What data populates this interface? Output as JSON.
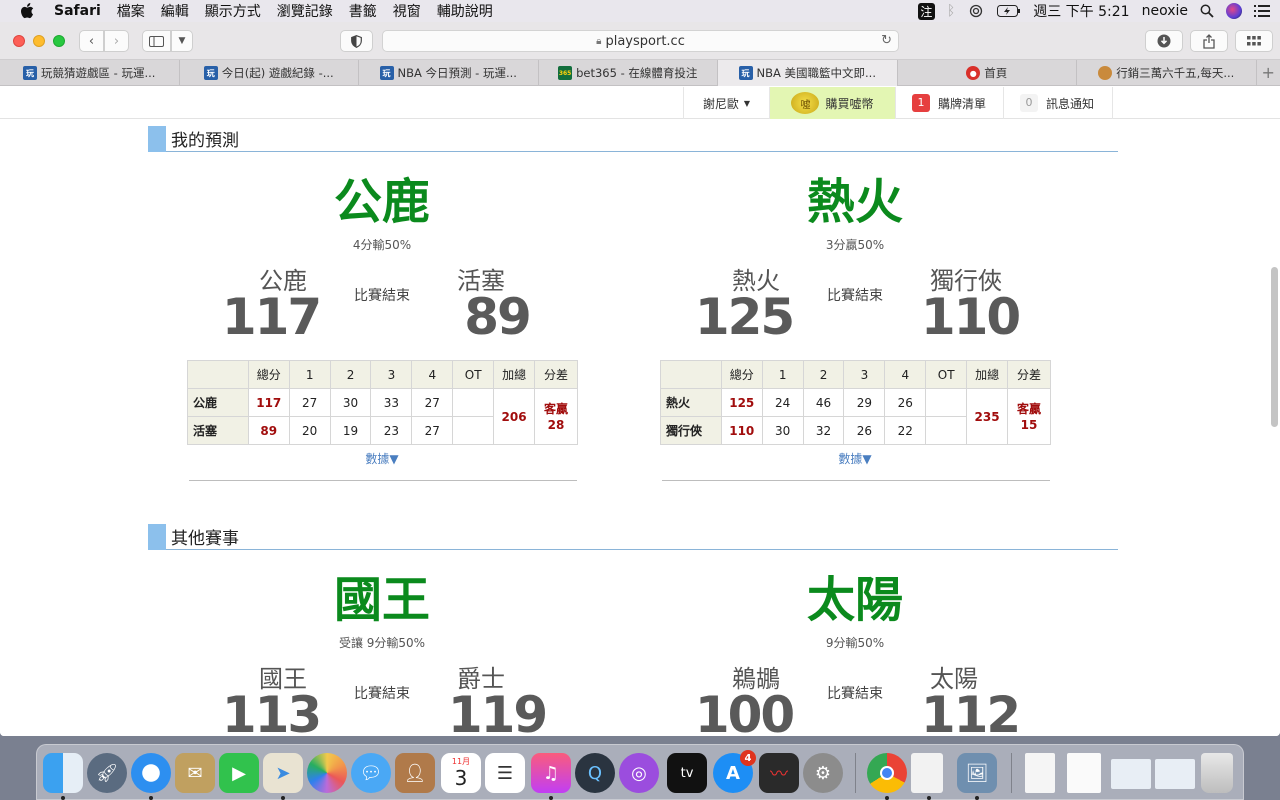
{
  "menubar": {
    "app": "Safari",
    "items": [
      "檔案",
      "編輯",
      "顯示方式",
      "瀏覽記錄",
      "書籤",
      "視窗",
      "輔助說明"
    ],
    "ime": "注",
    "clock": "週三 下午 5:21",
    "user": "neoxie"
  },
  "browser": {
    "url": "playsport.cc",
    "tabs": [
      {
        "label": "玩競猜遊戲區 - 玩運...",
        "favicon": "playsport",
        "active": false
      },
      {
        "label": "今日(起) 遊戲紀錄 -...",
        "favicon": "playsport",
        "active": false
      },
      {
        "label": "NBA 今日預測 - 玩運...",
        "favicon": "playsport",
        "active": false
      },
      {
        "label": "bet365 - 在線體育投注",
        "favicon": "bet365",
        "active": false
      },
      {
        "label": "NBA 美國職籃中文即...",
        "favicon": "playsport",
        "active": true
      },
      {
        "label": "首頁",
        "favicon": "home",
        "active": false
      },
      {
        "label": "行銷三萬六千五,每天...",
        "favicon": "bird",
        "active": false
      }
    ]
  },
  "header": {
    "user": "謝尼歐",
    "buy_coins": "購買噓幣",
    "cart_count": "1",
    "cart_label": "購牌清單",
    "notify_count": "0",
    "notify_label": "訊息通知"
  },
  "sections": {
    "mine": "我的預測",
    "others": "其他賽事"
  },
  "table_headers": [
    "總分",
    "1",
    "2",
    "3",
    "4",
    "OT",
    "加總",
    "分差"
  ],
  "games": [
    {
      "winner": "公鹿",
      "spread": "4分輸50%",
      "status": "比賽結束",
      "home": {
        "name": "公鹿",
        "score": "117",
        "quarters": [
          "27",
          "30",
          "33",
          "27"
        ],
        "ot": ""
      },
      "away": {
        "name": "活塞",
        "score": "89",
        "quarters": [
          "20",
          "19",
          "23",
          "27"
        ],
        "ot": ""
      },
      "sum": "206",
      "diff_label": "客贏",
      "diff_value": "28",
      "more": "數據▼"
    },
    {
      "winner": "熱火",
      "spread": "3分贏50%",
      "status": "比賽結束",
      "home": {
        "name": "熱火",
        "score": "125",
        "quarters": [
          "24",
          "46",
          "29",
          "26"
        ],
        "ot": ""
      },
      "away": {
        "name": "獨行俠",
        "score": "110",
        "quarters": [
          "30",
          "32",
          "26",
          "22"
        ],
        "ot": ""
      },
      "sum": "235",
      "diff_label": "客贏",
      "diff_value": "15",
      "more": "數據▼"
    },
    {
      "winner": "國王",
      "spread": "受讓 9分輸50%",
      "status": "比賽結束",
      "home": {
        "name": "國王",
        "score": "113"
      },
      "away": {
        "name": "爵士",
        "score": "119"
      }
    },
    {
      "winner": "太陽",
      "spread": "9分輸50%",
      "status": "比賽結束",
      "home": {
        "name": "鵜鶘",
        "score": "100"
      },
      "away": {
        "name": "太陽",
        "score": "112"
      }
    }
  ],
  "dock": {
    "appstore_badge": "4",
    "calendar_month": "11月",
    "calendar_day": "3",
    "tv_label": "tv"
  },
  "colors": {
    "winner_green": "#0b8a1d",
    "score_red": "#a10d0d",
    "section_accent": "#8cc0ec",
    "link_blue": "#4a7ec0"
  }
}
